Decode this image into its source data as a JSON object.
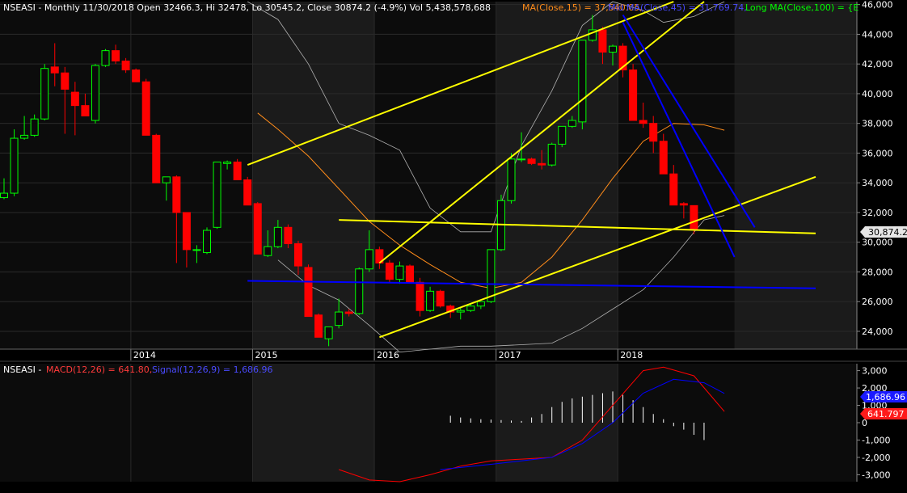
{
  "colors": {
    "background": "#000000",
    "plot_bg": "#0c0c0c",
    "year_band": "#1b1b1b",
    "grid": "#2a2a2a",
    "up_candle": "#00ff00",
    "down_candle": "#ff0000",
    "candle_outline": "#000000",
    "ma15": "#ff8c1a",
    "mid_ma45": "#0000ff",
    "long_ma100": "#00ff00",
    "trendline_yellow": "#ffff00",
    "trendline_blue": "#0000ff",
    "bollinger": "#b0b0b0",
    "macd_line": "#ff0000",
    "signal_line": "#0000ff",
    "histogram": "#ffffff",
    "axis_text": "#ffffff",
    "price_tag_bg": "#e6e6e6"
  },
  "header": {
    "symbol_line": "NSEASI - Monthly 11/30/2018 Open 32466.3, Hi 32478, Lo 30545.2, Close 30874.2 (-4.9%) Vol 5,438,578,688",
    "ma15_label": "MA(Close,15) = 37,540.05,",
    "mid_ma_label": "Mid MA(Close,45) = 31,769.74,",
    "long_ma_label": "Long MA(Close,100) = {E"
  },
  "macd_header": {
    "symbol": "NSEASI -",
    "macd_label": "MACD(12,26) = 641.80,",
    "signal_label": "Signal(12,26,9) = 1,686.96"
  },
  "price_tag": "30,874.2",
  "macd_tag": "641.797",
  "signal_tag": "1,686.96",
  "chart_data": {
    "type": "candlestick",
    "title": "NSEASI - Monthly",
    "price_axis": {
      "ylim": [
        22800,
        46200
      ],
      "ticks": [
        24000,
        26000,
        28000,
        30000,
        32000,
        34000,
        36000,
        38000,
        40000,
        42000,
        44000,
        46000
      ],
      "tick_labels": [
        "24,000",
        "26,000",
        "28,000",
        "30,000",
        "32,000",
        "34,000",
        "36,000",
        "38,000",
        "40,000",
        "42,000",
        "44,000",
        "46,000"
      ]
    },
    "x_labels": [
      "2014",
      "2015",
      "2016",
      "2017",
      "2018"
    ],
    "x_label_month_index": [
      13,
      25,
      37,
      49,
      61
    ],
    "months": [
      "2012-12",
      "2013-01",
      "2013-02",
      "2013-03",
      "2013-04",
      "2013-05",
      "2013-06",
      "2013-07",
      "2013-08",
      "2013-09",
      "2013-10",
      "2013-11",
      "2013-12",
      "2014-01",
      "2014-02",
      "2014-03",
      "2014-04",
      "2014-05",
      "2014-06",
      "2014-07",
      "2014-08",
      "2014-09",
      "2014-10",
      "2014-11",
      "2014-12",
      "2015-01",
      "2015-02",
      "2015-03",
      "2015-04",
      "2015-05",
      "2015-06",
      "2015-07",
      "2015-08",
      "2015-09",
      "2015-10",
      "2015-11",
      "2015-12",
      "2016-01",
      "2016-02",
      "2016-03",
      "2016-04",
      "2016-05",
      "2016-06",
      "2016-07",
      "2016-08",
      "2016-09",
      "2016-10",
      "2016-11",
      "2016-12",
      "2017-01",
      "2017-02",
      "2017-03",
      "2017-04",
      "2017-05",
      "2017-06",
      "2017-07",
      "2017-08",
      "2017-09",
      "2017-10",
      "2017-11",
      "2017-12",
      "2018-01",
      "2018-02",
      "2018-03",
      "2018-04",
      "2018-05",
      "2018-06",
      "2018-07",
      "2018-08",
      "2018-09",
      "2018-10",
      "2018-11"
    ],
    "ohlc": [
      [
        33000,
        34300,
        32900,
        33300
      ],
      [
        33300,
        37600,
        33100,
        37000
      ],
      [
        37000,
        38500,
        36900,
        37200
      ],
      [
        37200,
        38600,
        37100,
        38300
      ],
      [
        38300,
        42000,
        38200,
        41700
      ],
      [
        41800,
        43400,
        40500,
        41400
      ],
      [
        41400,
        41800,
        37300,
        40300
      ],
      [
        40100,
        40800,
        37200,
        39200
      ],
      [
        39200,
        40000,
        38900,
        38500
      ],
      [
        38200,
        42000,
        38000,
        41900
      ],
      [
        41900,
        43000,
        41800,
        42900
      ],
      [
        42900,
        43300,
        42000,
        42200
      ],
      [
        42200,
        42400,
        41400,
        41600
      ],
      [
        41600,
        41700,
        40900,
        40800
      ],
      [
        40800,
        41000,
        37500,
        37200
      ],
      [
        37200,
        37300,
        37000,
        34000
      ],
      [
        34000,
        34200,
        32800,
        34400
      ],
      [
        34400,
        34500,
        28600,
        32000
      ],
      [
        32000,
        31400,
        28300,
        29500
      ],
      [
        29500,
        29800,
        28600,
        29500
      ],
      [
        29300,
        31000,
        29200,
        30800
      ],
      [
        31000,
        33400,
        30900,
        35400
      ],
      [
        35300,
        35500,
        34900,
        35400
      ],
      [
        35400,
        35600,
        34300,
        34200
      ],
      [
        34200,
        34400,
        32700,
        32500
      ],
      [
        32600,
        32700,
        29500,
        29200
      ],
      [
        29100,
        30800,
        29000,
        29700
      ],
      [
        29700,
        31500,
        29600,
        31000
      ],
      [
        31000,
        31200,
        29600,
        29900
      ],
      [
        29900,
        30100,
        27800,
        28400
      ],
      [
        28300,
        28500,
        26900,
        25000
      ],
      [
        25100,
        25200,
        24400,
        23600
      ],
      [
        23500,
        23800,
        23000,
        24300
      ],
      [
        24400,
        26200,
        24200,
        25300
      ],
      [
        25300,
        25500,
        25000,
        25200
      ],
      [
        25200,
        28300,
        25100,
        28200
      ],
      [
        28200,
        30800,
        28000,
        29500
      ],
      [
        29500,
        29700,
        28200,
        28600
      ],
      [
        28600,
        28800,
        27300,
        27500
      ],
      [
        27500,
        28700,
        27200,
        28400
      ],
      [
        28400,
        28500,
        27400,
        27300
      ],
      [
        27300,
        27600,
        25000,
        25400
      ],
      [
        25400,
        27000,
        25300,
        26700
      ],
      [
        26700,
        26800,
        25600,
        25700
      ],
      [
        25700,
        25800,
        24900,
        25300
      ],
      [
        25300,
        25600,
        24800,
        25400
      ],
      [
        25400,
        25900,
        25300,
        25700
      ],
      [
        25700,
        26000,
        25500,
        26000
      ],
      [
        26000,
        29500,
        25900,
        29500
      ],
      [
        29500,
        33200,
        29400,
        32800
      ],
      [
        32800,
        36000,
        32600,
        35600
      ],
      [
        35600,
        37400,
        35400,
        35600
      ],
      [
        35600,
        35700,
        35200,
        35300
      ],
      [
        35300,
        36200,
        34900,
        35200
      ],
      [
        35200,
        36700,
        35100,
        36600
      ],
      [
        36600,
        37700,
        36400,
        37800
      ],
      [
        37800,
        38500,
        37700,
        38200
      ],
      [
        38100,
        42100,
        37600,
        43600
      ],
      [
        43600,
        45300,
        43500,
        44300
      ],
      [
        44300,
        44500,
        42000,
        42800
      ],
      [
        42800,
        43300,
        41900,
        43200
      ],
      [
        43200,
        43400,
        41100,
        41600
      ],
      [
        41600,
        42000,
        40100,
        38200
      ],
      [
        38200,
        39400,
        37700,
        38000
      ],
      [
        38000,
        38500,
        36000,
        36800
      ],
      [
        36800,
        37300,
        35100,
        34600
      ],
      [
        34600,
        35200,
        32600,
        32500
      ],
      [
        32600,
        32700,
        31600,
        32500
      ],
      [
        32466.3,
        32478,
        30545.2,
        30874.2
      ]
    ],
    "ma15": [
      [
        "2015-01",
        38700
      ],
      [
        "2015-03",
        37600
      ],
      [
        "2015-06",
        35800
      ],
      [
        "2015-09",
        33600
      ],
      [
        "2015-12",
        31400
      ],
      [
        "2016-03",
        29800
      ],
      [
        "2016-06",
        28500
      ],
      [
        "2016-09",
        27300
      ],
      [
        "2016-12",
        26900
      ],
      [
        "2017-03",
        27300
      ],
      [
        "2017-06",
        29000
      ],
      [
        "2017-09",
        31500
      ],
      [
        "2017-12",
        34300
      ],
      [
        "2018-03",
        36800
      ],
      [
        "2018-06",
        38000
      ],
      [
        "2018-09",
        37900
      ],
      [
        "2018-11",
        37540
      ]
    ],
    "bollinger_upper": [
      [
        "2014-12",
        46200
      ],
      [
        "2015-03",
        45000
      ],
      [
        "2015-06",
        42000
      ],
      [
        "2015-09",
        38000
      ],
      [
        "2015-12",
        37200
      ],
      [
        "2016-03",
        36200
      ],
      [
        "2016-06",
        32300
      ],
      [
        "2016-09",
        30700
      ],
      [
        "2016-12",
        30700
      ],
      [
        "2017-03",
        36500
      ],
      [
        "2017-06",
        40200
      ],
      [
        "2017-09",
        44600
      ],
      [
        "2017-12",
        46200
      ],
      [
        "2018-03",
        45600
      ],
      [
        "2018-05",
        44800
      ],
      [
        "2018-08",
        45200
      ],
      [
        "2018-11",
        46200
      ]
    ],
    "bollinger_lower": [
      [
        "2015-03",
        28800
      ],
      [
        "2015-06",
        27100
      ],
      [
        "2015-09",
        26100
      ],
      [
        "2015-12",
        24400
      ],
      [
        "2016-03",
        22600
      ],
      [
        "2016-06",
        22800
      ],
      [
        "2016-09",
        23000
      ],
      [
        "2016-12",
        23000
      ],
      [
        "2017-03",
        23100
      ],
      [
        "2017-06",
        23200
      ],
      [
        "2017-09",
        24200
      ],
      [
        "2017-12",
        25500
      ],
      [
        "2018-03",
        26800
      ],
      [
        "2018-06",
        29000
      ],
      [
        "2018-09",
        31500
      ],
      [
        "2018-11",
        31800
      ]
    ],
    "trendlines_yellow": [
      [
        [
          "2014-12",
          35200
        ],
        [
          "2018-06",
          46200
        ]
      ],
      [
        [
          "2016-01",
          28600
        ],
        [
          "2018-09",
          46200
        ]
      ],
      [
        [
          "2016-01",
          23600
        ],
        [
          "2019-08",
          34400
        ]
      ],
      [
        [
          "2015-09",
          31500
        ],
        [
          "2019-08",
          30600
        ]
      ]
    ],
    "trendlines_blue": [
      [
        [
          "2014-12",
          27400
        ],
        [
          "2019-08",
          26900
        ]
      ],
      [
        [
          "2018-01",
          44800
        ],
        [
          "2018-12",
          29000
        ]
      ],
      [
        [
          "2018-01",
          45300
        ],
        [
          "2019-02",
          31000
        ]
      ]
    ],
    "macd": {
      "ylim": [
        -3400,
        3400
      ],
      "ticks": [
        -3000,
        -2000,
        -1000,
        0,
        1000,
        2000,
        3000
      ],
      "tick_labels": [
        "-3,000",
        "-2,000",
        "-1,000",
        "0",
        "1,000",
        "2,000",
        "3,000"
      ],
      "macd_line": [
        [
          "2015-09",
          -2700
        ],
        [
          "2015-12",
          -3300
        ],
        [
          "2016-03",
          -3400
        ],
        [
          "2016-06",
          -3000
        ],
        [
          "2016-09",
          -2500
        ],
        [
          "2016-12",
          -2200
        ],
        [
          "2017-03",
          -2100
        ],
        [
          "2017-06",
          -2000
        ],
        [
          "2017-09",
          -1000
        ],
        [
          "2017-12",
          1000
        ],
        [
          "2018-03",
          3000
        ],
        [
          "2018-05",
          3200
        ],
        [
          "2018-08",
          2700
        ],
        [
          "2018-11",
          642
        ]
      ],
      "signal_line": [
        [
          "2016-07",
          -2700
        ],
        [
          "2016-12",
          -2400
        ],
        [
          "2017-06",
          -2000
        ],
        [
          "2017-09",
          -1200
        ],
        [
          "2017-12",
          0
        ],
        [
          "2018-03",
          1700
        ],
        [
          "2018-06",
          2500
        ],
        [
          "2018-09",
          2300
        ],
        [
          "2018-11",
          1687
        ]
      ],
      "histogram": [
        [
          "2016-08",
          400
        ],
        [
          "2016-09",
          300
        ],
        [
          "2016-10",
          250
        ],
        [
          "2016-11",
          200
        ],
        [
          "2016-12",
          180
        ],
        [
          "2017-01",
          150
        ],
        [
          "2017-02",
          120
        ],
        [
          "2017-03",
          100
        ],
        [
          "2017-04",
          300
        ],
        [
          "2017-05",
          500
        ],
        [
          "2017-06",
          900
        ],
        [
          "2017-07",
          1200
        ],
        [
          "2017-08",
          1400
        ],
        [
          "2017-09",
          1500
        ],
        [
          "2017-10",
          1600
        ],
        [
          "2017-11",
          1700
        ],
        [
          "2017-12",
          1800
        ],
        [
          "2018-01",
          1600
        ],
        [
          "2018-02",
          1300
        ],
        [
          "2018-03",
          900
        ],
        [
          "2018-04",
          500
        ],
        [
          "2018-05",
          200
        ],
        [
          "2018-06",
          -200
        ],
        [
          "2018-07",
          -400
        ],
        [
          "2018-08",
          -700
        ],
        [
          "2018-09",
          -1000
        ]
      ]
    }
  }
}
